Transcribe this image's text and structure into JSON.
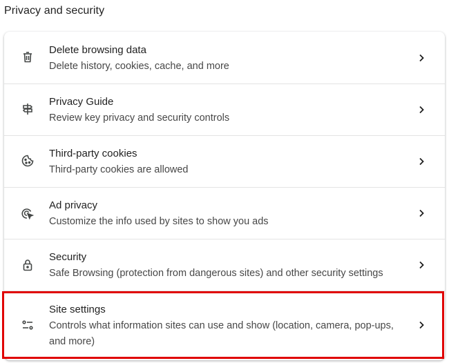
{
  "section": {
    "title": "Privacy and security"
  },
  "rows": [
    {
      "label": "Delete browsing data",
      "sublabel": "Delete history, cookies, cache, and more",
      "icon": "trash-icon"
    },
    {
      "label": "Privacy Guide",
      "sublabel": "Review key privacy and security controls",
      "icon": "signpost-icon"
    },
    {
      "label": "Third-party cookies",
      "sublabel": "Third-party cookies are allowed",
      "icon": "cookie-icon"
    },
    {
      "label": "Ad privacy",
      "sublabel": "Customize the info used by sites to show you ads",
      "icon": "ad-privacy-icon"
    },
    {
      "label": "Security",
      "sublabel": "Safe Browsing (protection from dangerous sites) and other security settings",
      "icon": "lock-icon"
    },
    {
      "label": "Site settings",
      "sublabel": "Controls what information sites can use and show (location, camera, pop-ups, and more)",
      "icon": "tune-icon"
    }
  ],
  "highlight": {
    "color": "#e00000",
    "target": "Site settings"
  },
  "colors": {
    "label": "#1f1f1f",
    "sublabel": "#474747",
    "divider": "#e3e3e3"
  }
}
